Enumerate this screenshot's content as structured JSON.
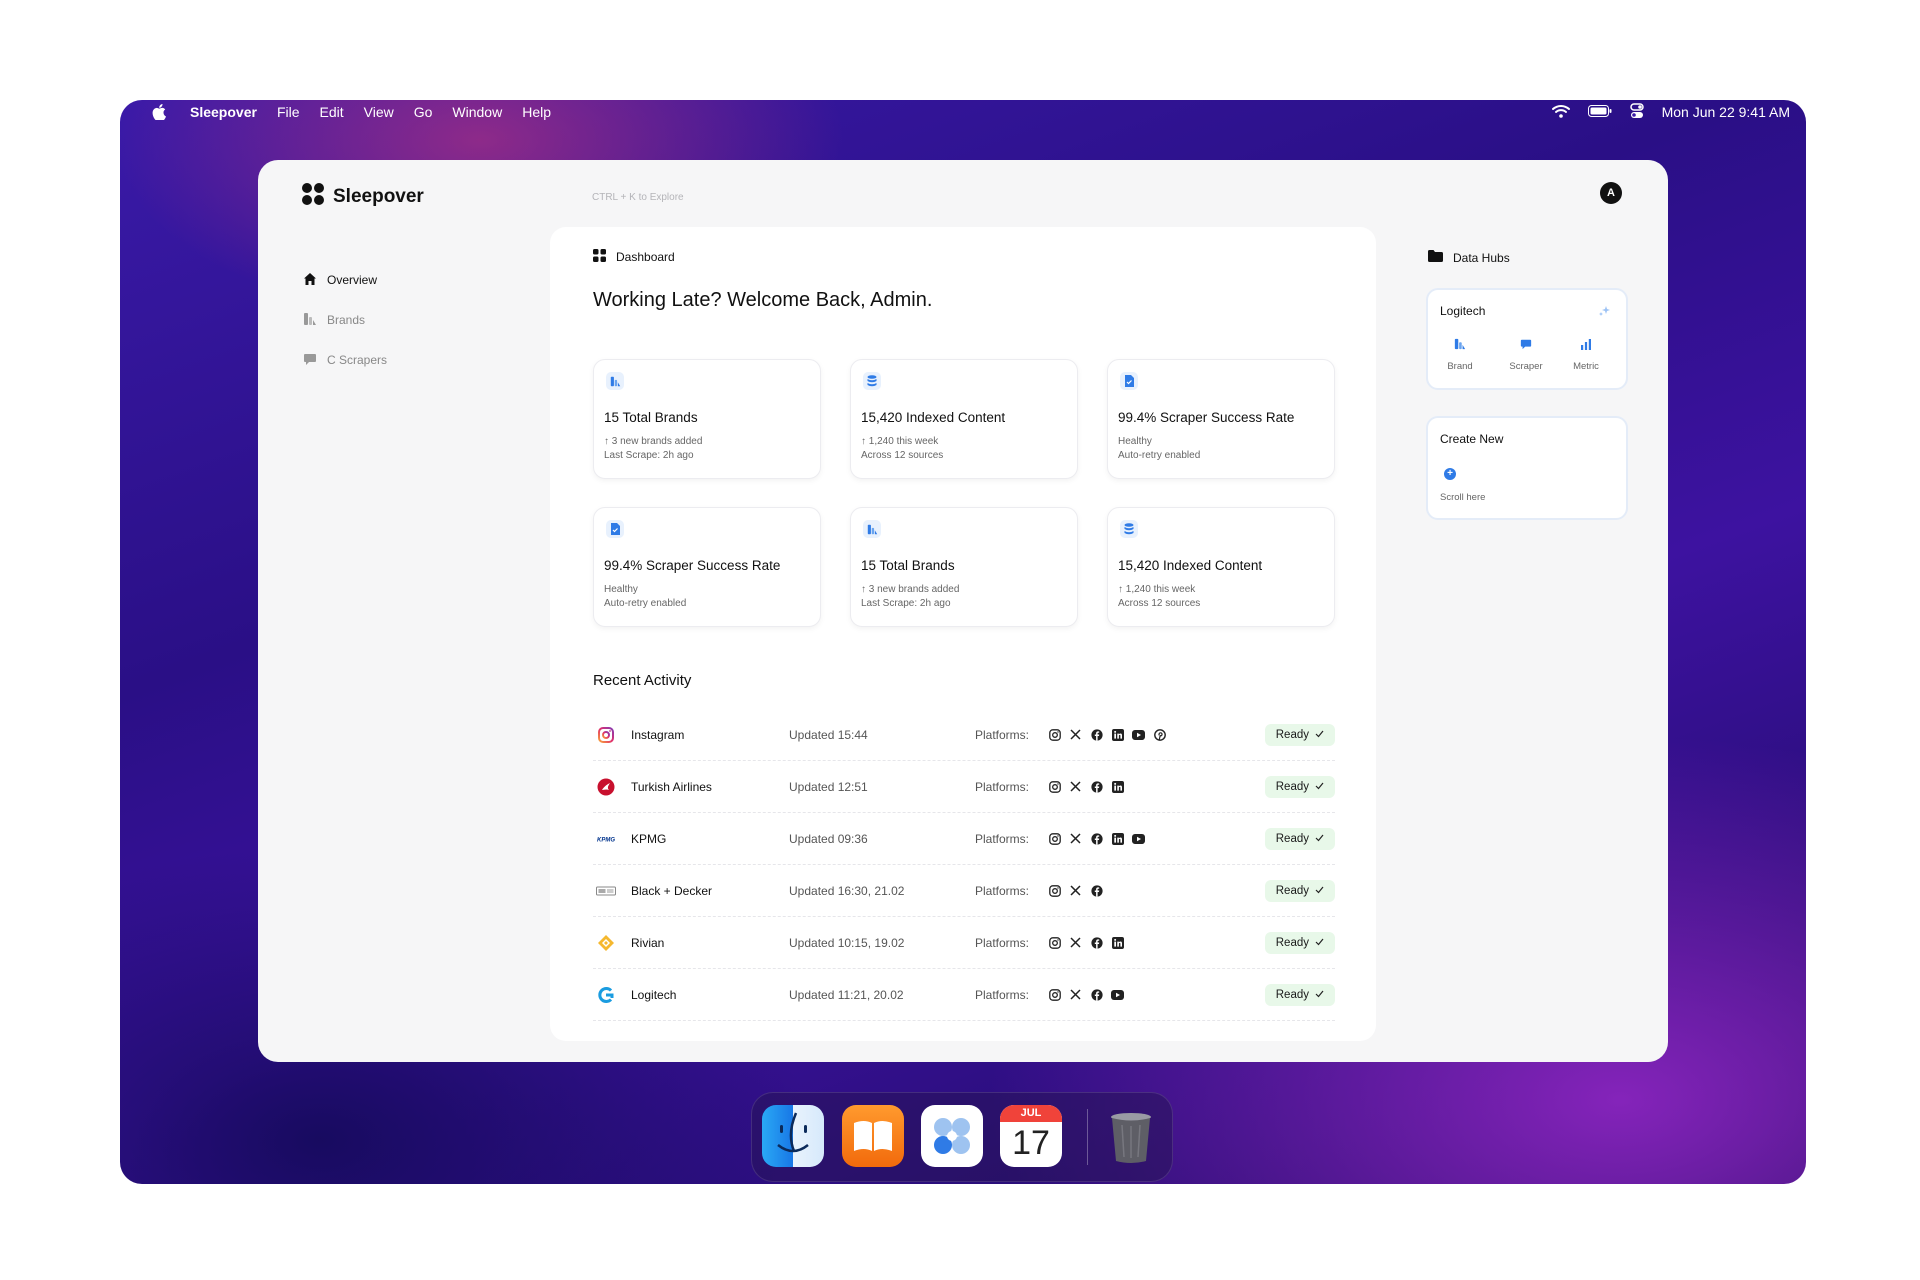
{
  "menubar": {
    "app_name": "Sleepover",
    "items": [
      "File",
      "Edit",
      "View",
      "Go",
      "Window",
      "Help"
    ],
    "datetime": "Mon Jun 22  9:41 AM"
  },
  "header": {
    "brand_name": "Sleepover",
    "shortcut_hint": "CTRL + K to Explore",
    "avatar_initial": "A"
  },
  "sidebar": {
    "items": [
      {
        "label": "Overview",
        "icon": "home-icon",
        "active": true
      },
      {
        "label": "Brands",
        "icon": "brands-icon",
        "active": false
      },
      {
        "label": "C Scrapers",
        "icon": "chat-icon",
        "active": false
      }
    ]
  },
  "main": {
    "section_label": "Dashboard",
    "welcome": "Working Late? Welcome Back, Admin.",
    "cards": [
      {
        "icon": "brands-icon",
        "title": "15 Total Brands",
        "line1": "↑ 3 new brands added",
        "line2": "Last Scrape: 2h ago"
      },
      {
        "icon": "database-icon",
        "title": "15,420 Indexed Content",
        "line1": "↑ 1,240 this week",
        "line2": "Across 12 sources"
      },
      {
        "icon": "document-icon",
        "title": "99.4% Scraper Success Rate",
        "line1": "Healthy",
        "line2": "Auto-retry enabled"
      },
      {
        "icon": "document-icon",
        "title": "99.4% Scraper Success Rate",
        "line1": "Healthy",
        "line2": "Auto-retry enabled"
      },
      {
        "icon": "brands-icon",
        "title": "15 Total Brands",
        "line1": "↑ 3 new brands added",
        "line2": "Last Scrape: 2h ago"
      },
      {
        "icon": "database-icon",
        "title": "15,420 Indexed Content",
        "line1": "↑ 1,240 this week",
        "line2": "Across 12 sources"
      }
    ],
    "recent_title": "Recent Activity",
    "platforms_label": "Platforms:",
    "activity": [
      {
        "name": "Instagram",
        "updated": "Updated 15:44",
        "platforms": [
          "instagram",
          "x",
          "facebook",
          "linkedin",
          "youtube",
          "pinterest"
        ],
        "status": "Ready",
        "logo": "instagram-logo"
      },
      {
        "name": "Turkish Airlines",
        "updated": "Updated 12:51",
        "platforms": [
          "instagram",
          "x",
          "facebook",
          "linkedin"
        ],
        "status": "Ready",
        "logo": "turkish-airlines-logo"
      },
      {
        "name": "KPMG",
        "updated": "Updated 09:36",
        "platforms": [
          "instagram",
          "x",
          "facebook",
          "linkedin",
          "youtube"
        ],
        "status": "Ready",
        "logo": "kpmg-logo"
      },
      {
        "name": "Black + Decker",
        "updated": "Updated 16:30, 21.02",
        "platforms": [
          "instagram",
          "x",
          "facebook"
        ],
        "status": "Ready",
        "logo": "black-decker-logo"
      },
      {
        "name": "Rivian",
        "updated": "Updated 10:15, 19.02",
        "platforms": [
          "instagram",
          "x",
          "facebook",
          "linkedin"
        ],
        "status": "Ready",
        "logo": "rivian-logo"
      },
      {
        "name": "Logitech",
        "updated": "Updated 11:21, 20.02",
        "platforms": [
          "instagram",
          "x",
          "facebook",
          "youtube"
        ],
        "status": "Ready",
        "logo": "logitech-logo"
      }
    ]
  },
  "hubs": {
    "title": "Data Hubs",
    "hub1": {
      "title": "Logitech",
      "items": [
        "Brand",
        "Scraper",
        "Metric"
      ]
    },
    "hub2": {
      "title": "Create New",
      "hint": "Scroll here"
    }
  },
  "dock": {
    "apps": [
      "Finder",
      "Books",
      "Sleepover",
      "Calendar",
      "Trash"
    ],
    "calendar_month": "JUL",
    "calendar_day": "17"
  },
  "colors": {
    "accent": "#2f7be6",
    "ready_bg": "#e8f8e9"
  }
}
